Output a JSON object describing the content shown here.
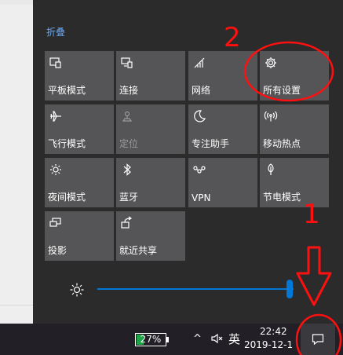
{
  "action_center": {
    "collapse_label": "折叠",
    "tiles": [
      {
        "label": "平板模式",
        "icon": "tablet-mode-icon"
      },
      {
        "label": "连接",
        "icon": "connect-icon"
      },
      {
        "label": "网络",
        "icon": "network-icon"
      },
      {
        "label": "所有设置",
        "icon": "gear-icon"
      },
      {
        "label": "飞行模式",
        "icon": "airplane-icon"
      },
      {
        "label": "定位",
        "icon": "location-icon",
        "state": "disabled"
      },
      {
        "label": "专注助手",
        "icon": "moon-icon"
      },
      {
        "label": "移动热点",
        "icon": "hotspot-icon"
      },
      {
        "label": "夜间模式",
        "icon": "night-light-icon"
      },
      {
        "label": "蓝牙",
        "icon": "bluetooth-icon"
      },
      {
        "label": "VPN",
        "icon": "vpn-icon"
      },
      {
        "label": "节电模式",
        "icon": "battery-saver-icon"
      },
      {
        "label": "投影",
        "icon": "project-icon"
      },
      {
        "label": "就近共享",
        "icon": "nearby-share-icon"
      }
    ],
    "brightness": {
      "icon": "sun-icon",
      "level": 1.0
    }
  },
  "taskbar": {
    "battery_percent": "27%",
    "chevron": "^",
    "ime": "英",
    "time": "22:42",
    "date": "2019-12-1",
    "notification_icon": "notification-icon"
  },
  "annotations": [
    "2",
    "1"
  ],
  "colors": {
    "accent": "#0078d7",
    "annotation": "#ff1010",
    "tile": "#555557"
  }
}
